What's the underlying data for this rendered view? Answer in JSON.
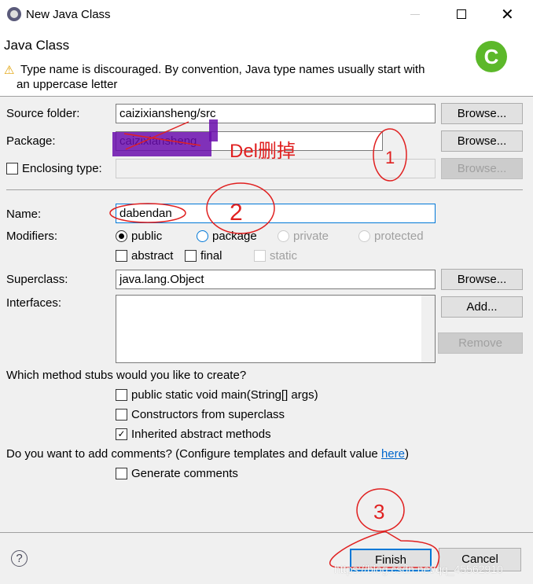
{
  "window": {
    "title": "New Java Class",
    "icon": "eclipse-icon"
  },
  "header": {
    "title": "Java Class",
    "warning": "Type name is discouraged. By convention, Java type names usually start with",
    "warning2": "an uppercase letter",
    "logo": "java-class-icon"
  },
  "form": {
    "source_folder": {
      "label": "Source folder:",
      "value": "caizixiansheng/src",
      "browse": "Browse..."
    },
    "package": {
      "label": "Package:",
      "value": "caizixiansheng",
      "browse": "Browse..."
    },
    "enclosing": {
      "label": "Enclosing type:",
      "value": "",
      "browse": "Browse...",
      "checked": false
    },
    "name": {
      "label": "Name:",
      "value": "dabendan"
    },
    "modifiers": {
      "label": "Modifiers:",
      "public": "public",
      "package": "package",
      "private": "private",
      "protected": "protected",
      "abstract": "abstract",
      "final": "final",
      "static": "static",
      "selected": "public"
    },
    "superclass": {
      "label": "Superclass:",
      "value": "java.lang.Object",
      "browse": "Browse..."
    },
    "interfaces": {
      "label": "Interfaces:",
      "add": "Add...",
      "remove": "Remove"
    },
    "stubs": {
      "question": "Which method stubs would you like to create?",
      "main": "public static void main(String[] args)",
      "constructors": "Constructors from superclass",
      "inherited": "Inherited abstract methods"
    },
    "comments": {
      "question": "Do you want to add comments? (Configure templates and default value ",
      "link": "here",
      "question_end": ")",
      "generate": "Generate comments"
    }
  },
  "footer": {
    "finish": "Finish",
    "cancel": "Cancel"
  },
  "annotations": {
    "note": "Del删掉",
    "one": "1",
    "two": "2",
    "three": "3",
    "color": "#e02020",
    "highlight": "#6a0dad"
  },
  "watermark": "https://blog.csdn.net/qq_45562910"
}
